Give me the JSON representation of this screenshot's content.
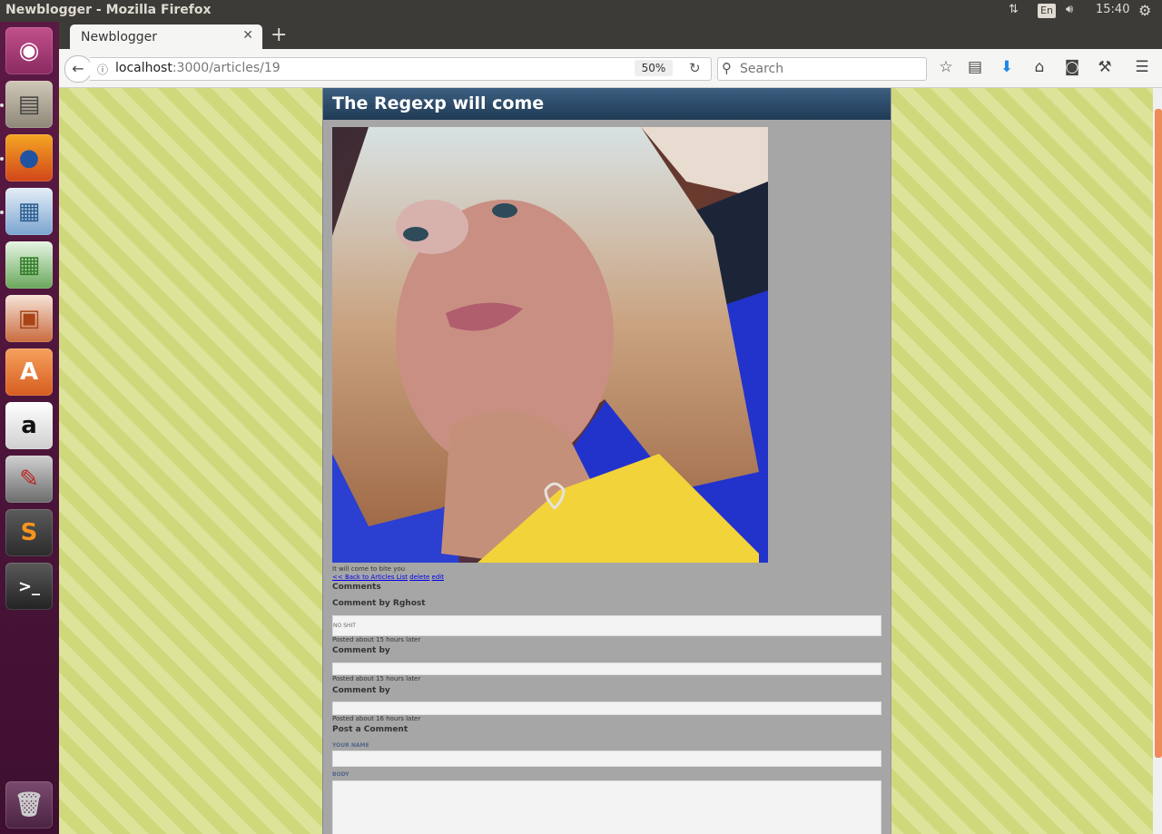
{
  "window": {
    "title": "Newblogger - Mozilla Firefox"
  },
  "panel": {
    "lang": "En",
    "clock": "15:40"
  },
  "launcher": {
    "items": [
      "ubuntu-dash",
      "files",
      "firefox",
      "writer",
      "calc",
      "impress",
      "software-center",
      "amazon",
      "system-settings",
      "sublime-text",
      "terminal",
      "trash"
    ]
  },
  "browser": {
    "tab_title": "Newblogger",
    "url_host": "localhost",
    "url_path": ":3000/articles/19",
    "zoom": "50%",
    "search_placeholder": "Search"
  },
  "article": {
    "title": "The Regexp will come",
    "caption": "It will come to bite you",
    "links": {
      "back": "<< Back to Articles List",
      "delete": "delete",
      "edit": "edit"
    },
    "comments_heading": "Comments",
    "comments": [
      {
        "heading": "Comment by Rghost",
        "body": "NO SHIT",
        "posted": "Posted about 15 hours later"
      },
      {
        "heading": "Comment by",
        "body": "",
        "posted": "Posted about 15 hours later"
      },
      {
        "heading": "Comment by",
        "body": "",
        "posted": "Posted about 16 hours later"
      }
    ],
    "form": {
      "heading": "Post a Comment",
      "name_label": "YOUR NAME",
      "body_label": "BODY"
    }
  },
  "colors": {
    "launcher": "#4a1438",
    "header": "#2c4a69",
    "article_bg": "#a6a6a6",
    "page_stripe_a": "#dde49a",
    "page_stripe_b": "#cfd97c",
    "scroll_thumb": "#ef8a5a"
  }
}
